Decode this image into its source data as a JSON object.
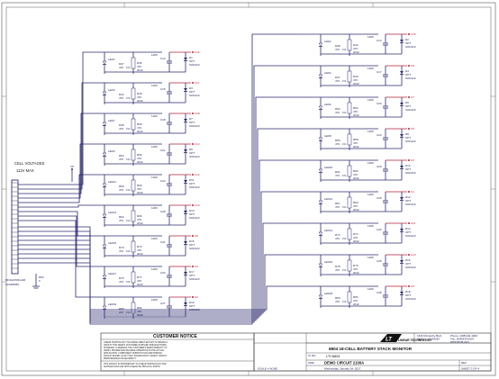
{
  "cell_voltages": {
    "title": "CELL VOLTAGES",
    "max": "112V MAX"
  },
  "connector": {
    "part": "MOLEX/MILLER",
    "number": "104308050"
  },
  "vp_label": "VP",
  "gnd_resistor": {
    "ref": "R93",
    "value": "0"
  },
  "left_stages": [
    {
      "led": "LED1",
      "r1": "R37",
      "r2": "R45",
      "cap": "C13",
      "diode": "D1",
      "res_val": "470",
      "pct": "1%",
      "pkg": "2012",
      "num": "1206",
      "diode_note": "OPT",
      "diode_pkg": "SOD123",
      "tp": "C16"
    },
    {
      "led": "LED3",
      "r1": "R43",
      "r2": "R46",
      "cap": "C15",
      "diode": "D3",
      "res_val": "470",
      "pct": "1%",
      "pkg": "2012",
      "num": "1206",
      "diode_note": "OPT",
      "diode_pkg": "SOD123",
      "tp": "C17"
    },
    {
      "led": "LED7",
      "r1": "R48",
      "r2": "R50",
      "cap": "C18",
      "diode": "D7",
      "res_val": "470",
      "pct": "1%",
      "pkg": "2012",
      "num": "1206",
      "diode_note": "OPT",
      "diode_pkg": "SOD123",
      "tp": "C18"
    },
    {
      "led": "LED9",
      "r1": "R54",
      "r2": "R56",
      "cap": "C21",
      "diode": "D9",
      "res_val": "470",
      "pct": "1%",
      "pkg": "2012",
      "num": "1206",
      "diode_note": "OPT",
      "diode_pkg": "SOD123",
      "tp": "C14"
    },
    {
      "led": "LED11",
      "r1": "R59",
      "r2": "R60",
      "cap": "C24",
      "diode": "D11",
      "res_val": "470",
      "pct": "1%",
      "pkg": "2012",
      "num": "1206",
      "diode_note": "OPT",
      "diode_pkg": "SOD123",
      "tp": "C12"
    },
    {
      "led": "LED13",
      "r1": "R64",
      "r2": "R66",
      "cap": "C28",
      "diode": "D13",
      "res_val": "470",
      "pct": "1%",
      "pkg": "2012",
      "num": "1206",
      "diode_note": "OPT",
      "diode_pkg": "SOD123",
      "tp": "C10"
    },
    {
      "led": "LED15",
      "r1": "R70",
      "r2": "R72",
      "cap": "C31",
      "diode": "D15",
      "res_val": "470",
      "pct": "1%",
      "pkg": "2012",
      "num": "1206",
      "diode_note": "OPT",
      "diode_pkg": "SOD123",
      "tp": "C8"
    },
    {
      "led": "LED17",
      "r1": "R75",
      "r2": "R77",
      "cap": "C34",
      "diode": "D17",
      "res_val": "470",
      "pct": "1%",
      "pkg": "2012",
      "num": "1206",
      "diode_note": "OPT",
      "diode_pkg": "SOD123",
      "tp": "C4"
    },
    {
      "led": "LED19",
      "r1": "R80",
      "r2": "R82",
      "cap": "C37",
      "diode": "D19",
      "res_val": "470",
      "pct": "1%",
      "pkg": "2012",
      "num": "1206",
      "diode_note": "OPT",
      "diode_pkg": "SOD123",
      "tp": "C2"
    }
  ],
  "right_stages": [
    {
      "led": "LED2",
      "r1": "R38",
      "r2": "R44",
      "cap": "C14",
      "diode": "D2",
      "res_val": "470",
      "pct": "1%",
      "pkg": "2012",
      "num": "1206",
      "diode_note": "OPT",
      "diode_pkg": "SOD123",
      "tp": "C15"
    },
    {
      "led": "LED4",
      "r1": "R47",
      "r2": "R49",
      "cap": "C17",
      "diode": "D4",
      "res_val": "470",
      "pct": "1%",
      "pkg": "2012",
      "num": "1206",
      "diode_note": "OPT",
      "diode_pkg": "SOD123",
      "tp": "C9"
    },
    {
      "led": "LED6",
      "r1": "R52",
      "r2": "R53",
      "cap": "C20",
      "diode": "D6",
      "res_val": "470",
      "pct": "1%",
      "pkg": "2012",
      "num": "1206",
      "diode_note": "OPT",
      "diode_pkg": "SOD123",
      "tp": "C7"
    },
    {
      "led": "LED8",
      "r1": "R55",
      "r2": "R58",
      "cap": "C23",
      "diode": "D8",
      "res_val": "470",
      "pct": "1%",
      "pkg": "2012",
      "num": "1206",
      "diode_note": "OPT",
      "diode_pkg": "SOD123",
      "tp": "C5"
    },
    {
      "led": "LED10",
      "r1": "R61",
      "r2": "R63",
      "cap": "C26",
      "diode": "D10",
      "res_val": "470",
      "pct": "1%",
      "pkg": "2012",
      "num": "1206",
      "diode_note": "OPT",
      "diode_pkg": "SOD123",
      "tp": "C3"
    },
    {
      "led": "LED12",
      "r1": "R67",
      "r2": "R69",
      "cap": "C29",
      "diode": "D12",
      "res_val": "470",
      "pct": "1%",
      "pkg": "2012",
      "num": "1206",
      "diode_note": "OPT",
      "diode_pkg": "SOD123",
      "tp": "C1"
    },
    {
      "led": "LED14",
      "r1": "R73",
      "r2": "R74",
      "cap": "C32",
      "diode": "D14",
      "res_val": "470",
      "pct": "1%",
      "pkg": "2012",
      "num": "1206",
      "diode_note": "OPT",
      "diode_pkg": "SOD123",
      "tp": "C11"
    },
    {
      "led": "LED16",
      "r1": "R78",
      "r2": "R79",
      "cap": "C35",
      "diode": "D16",
      "res_val": "470",
      "pct": "1%",
      "pkg": "2012",
      "num": "1206",
      "diode_note": "OPT",
      "diode_pkg": "SOD123",
      "tp": "C13"
    },
    {
      "led": "LED18",
      "r1": "R83",
      "r2": "R84",
      "cap": "C38",
      "diode": "D18",
      "res_val": "470",
      "pct": "1%",
      "pkg": "2012",
      "num": "1206",
      "diode_note": "OPT",
      "diode_pkg": "SOD123",
      "tp": "C6"
    }
  ],
  "customer_notice": {
    "heading": "CUSTOMER NOTICE",
    "body_lines": [
      "LINEAR TECHNOLOGY HAS MADE A BEST EFFORT TO DESIGN A",
      "CIRCUIT THAT MEETS CUSTOMER-SUPPLIED SPECIFICATIONS;",
      "HOWEVER, IT REMAINS THE CUSTOMER'S RESPONSIBILITY TO",
      "VERIFY PROPER AND RELIABLE OPERATION IN THE ACTUAL",
      "APPLICATION. COMPONENT SUBSTITUTION AND PRINTED",
      "CIRCUIT BOARD LAYOUT MAY SIGNIFICANTLY AFFECT CIRCUIT",
      "PERFORMANCE OR RELIABILITY."
    ],
    "footer_lines": [
      "THIS CIRCUIT IS PROPRIETARY TO LINEAR TECHNOLOGY AND",
      "SUPPLIED FOR USE WITH LINEAR TECHNOLOGY PARTS."
    ]
  },
  "title_block": {
    "company": "LINEAR TECHNOLOGY",
    "logo_text": "LT",
    "address": [
      "1630 McCarthy Blvd.",
      "Milpitas, CA 95035"
    ],
    "phone": "Phone: (408)432-1900",
    "fax": "Fax: (408)434-0507",
    "web": "www.linear.com",
    "title": "6804 18-CELL BATTERY STACK MONITOR",
    "ic_label": "IC NO.",
    "ic": "LTC6804",
    "circuit": "DEMO CIRCUIT 2100A",
    "date": "Wednesday, January 04, 2017",
    "scale": "SCALE = NONE",
    "sheet": "SHEET 3 OF 4",
    "size_label": "SIZE",
    "rev_label": "REV"
  }
}
